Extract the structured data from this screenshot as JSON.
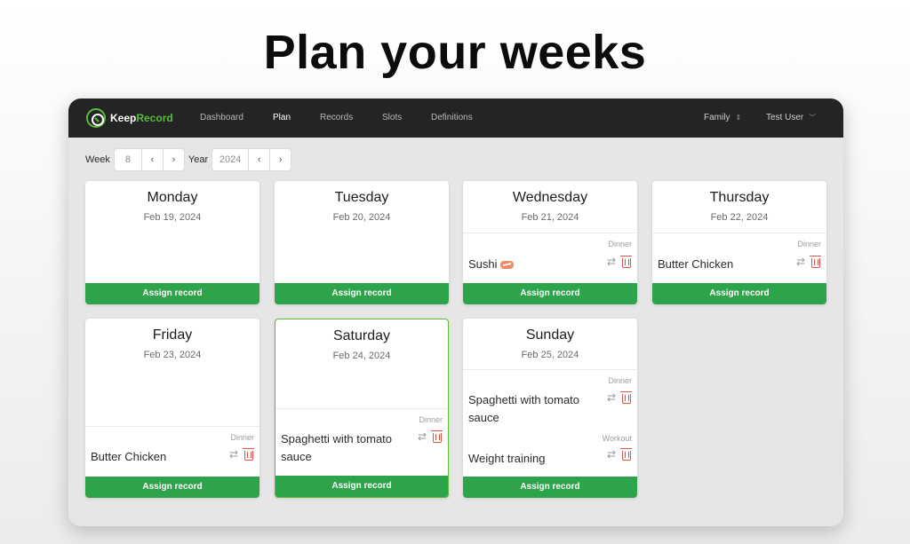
{
  "hero": {
    "title": "Plan your weeks"
  },
  "brand": {
    "name_part1": "Keep",
    "name_part2": "Record",
    "accent_color": "#5bbb3b"
  },
  "nav": {
    "links": [
      "Dashboard",
      "Plan",
      "Records",
      "Slots",
      "Definitions"
    ],
    "active": "Plan",
    "family_select": "Family",
    "user_menu": "Test User"
  },
  "controls": {
    "week_label": "Week",
    "week_value": "8",
    "year_label": "Year",
    "year_value": "2024",
    "prev_glyph": "‹",
    "next_glyph": "›"
  },
  "assign_label": "Assign record",
  "days": [
    {
      "name": "Monday",
      "date": "Feb 19, 2024",
      "entries": []
    },
    {
      "name": "Tuesday",
      "date": "Feb 20, 2024",
      "entries": []
    },
    {
      "name": "Wednesday",
      "date": "Feb 21, 2024",
      "entries": [
        {
          "slot": "Dinner",
          "record": "Sushi",
          "emoji": "sushi-emoji"
        }
      ]
    },
    {
      "name": "Thursday",
      "date": "Feb 22, 2024",
      "entries": [
        {
          "slot": "Dinner",
          "record": "Butter Chicken"
        }
      ]
    },
    {
      "name": "Friday",
      "date": "Feb 23, 2024",
      "entries": [
        {
          "slot": "Dinner",
          "record": "Butter Chicken"
        }
      ]
    },
    {
      "name": "Saturday",
      "date": "Feb 24, 2024",
      "entries": [
        {
          "slot": "Dinner",
          "record": "Spaghetti with tomato sauce"
        }
      ]
    },
    {
      "name": "Sunday",
      "date": "Feb 25, 2024",
      "entries": [
        {
          "slot": "Dinner",
          "record": "Spaghetti with tomato sauce"
        },
        {
          "slot": "Workout",
          "record": "Weight training"
        }
      ]
    }
  ],
  "icons": {
    "swap": "swap-arrows-icon",
    "delete": "trash-icon",
    "select_caret": "updown-caret-icon",
    "user_caret": "chevron-down-icon"
  },
  "colors": {
    "assign_button": "#2ea44a",
    "delete": "#e0524c",
    "navbar": "#242424"
  }
}
